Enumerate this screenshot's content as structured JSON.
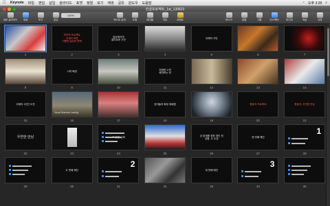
{
  "menubar": {
    "app": "Keynote",
    "items": [
      "파일",
      "편집",
      "삽입",
      "슬라이드",
      "포맷",
      "정렬",
      "보기",
      "재생",
      "공유",
      "윈도우",
      "도움말"
    ],
    "clock": "오후 3:28"
  },
  "window": {
    "title": "한글프로젝트_1st_130823"
  },
  "toolbar": {
    "buttons": [
      "새로 슬라이드",
      "재생",
      "보기",
      "공유",
      "텍스트 상자",
      "도형",
      "테이블",
      "차트",
      "코멘트",
      "마스크",
      "정렬",
      "그룹",
      "인스펙터",
      "미디어",
      "색상",
      "서체"
    ],
    "zoom": "100%"
  },
  "slides": [
    {
      "n": "1",
      "text": "",
      "kind": "photo-books"
    },
    {
      "n": "2",
      "text": "초보자 프로젝트\n자세히 보면\n이름한 일상의 변화",
      "red": true
    },
    {
      "n": "3",
      "text": "일상에서의\n흥미로운 고민"
    },
    {
      "n": "4",
      "text": "",
      "kind": "photo-people"
    },
    {
      "n": "5",
      "text": "이해의 고민"
    },
    {
      "n": "6",
      "text": "",
      "kind": "photo-food"
    },
    {
      "n": "7",
      "text": "",
      "kind": "photo-red"
    },
    {
      "n": "8",
      "text": "",
      "kind": "photo-child"
    },
    {
      "n": "9",
      "text": "나의 배경"
    },
    {
      "n": "10",
      "text": "",
      "kind": "photo-street"
    },
    {
      "n": "11",
      "text": "저렴한 노력\n해야하는 변"
    },
    {
      "n": "12",
      "text": "",
      "kind": "photo-person"
    },
    {
      "n": "13",
      "text": "",
      "kind": "photo-warm"
    },
    {
      "n": "14",
      "text": "",
      "kind": "photo-bright"
    },
    {
      "n": "15",
      "text": "이제의 1년간 도전"
    },
    {
      "n": "16",
      "text": "Yonsei Business Leading",
      "kind": "photo-building"
    },
    {
      "n": "17",
      "text": "",
      "kind": "photo-group"
    },
    {
      "n": "18",
      "text": "장치들의 화된 재배법"
    },
    {
      "n": "19",
      "text": "",
      "kind": "photo-fog"
    },
    {
      "n": "20",
      "text": "활동지 프로젝트",
      "red": true
    },
    {
      "n": "21",
      "text": "활동지, 우연한 만남",
      "red": true
    },
    {
      "n": "22",
      "text": "우연한 만남",
      "kind": "dark-big"
    },
    {
      "n": "23",
      "text": "",
      "kind": "poster"
    },
    {
      "n": "24",
      "text": "또 한번 실패",
      "kind": "list"
    },
    {
      "n": "25",
      "text": "",
      "kind": "photo-sport"
    },
    {
      "n": "26",
      "text": "곧 완제품 위한 개인 첫\n공통. 두 수업"
    },
    {
      "n": "27",
      "text": "첫 번째 혜진"
    },
    {
      "n": "28",
      "text": "",
      "kind": "num-1",
      "big": "1"
    },
    {
      "n": "29",
      "text": "",
      "kind": "list-photo"
    },
    {
      "n": "30",
      "text": "두 번째 혜진"
    },
    {
      "n": "31",
      "text": "",
      "kind": "num-2",
      "big": "2"
    },
    {
      "n": "32",
      "text": "",
      "kind": "photo-crowd"
    },
    {
      "n": "33",
      "text": "세 번째 혜진"
    },
    {
      "n": "34",
      "text": "",
      "kind": "num-3",
      "big": "3"
    },
    {
      "n": "35",
      "text": "",
      "kind": "list-photo"
    }
  ],
  "colors": {
    "selected": "#5b9cff",
    "accent_red": "#ff5a4a"
  }
}
